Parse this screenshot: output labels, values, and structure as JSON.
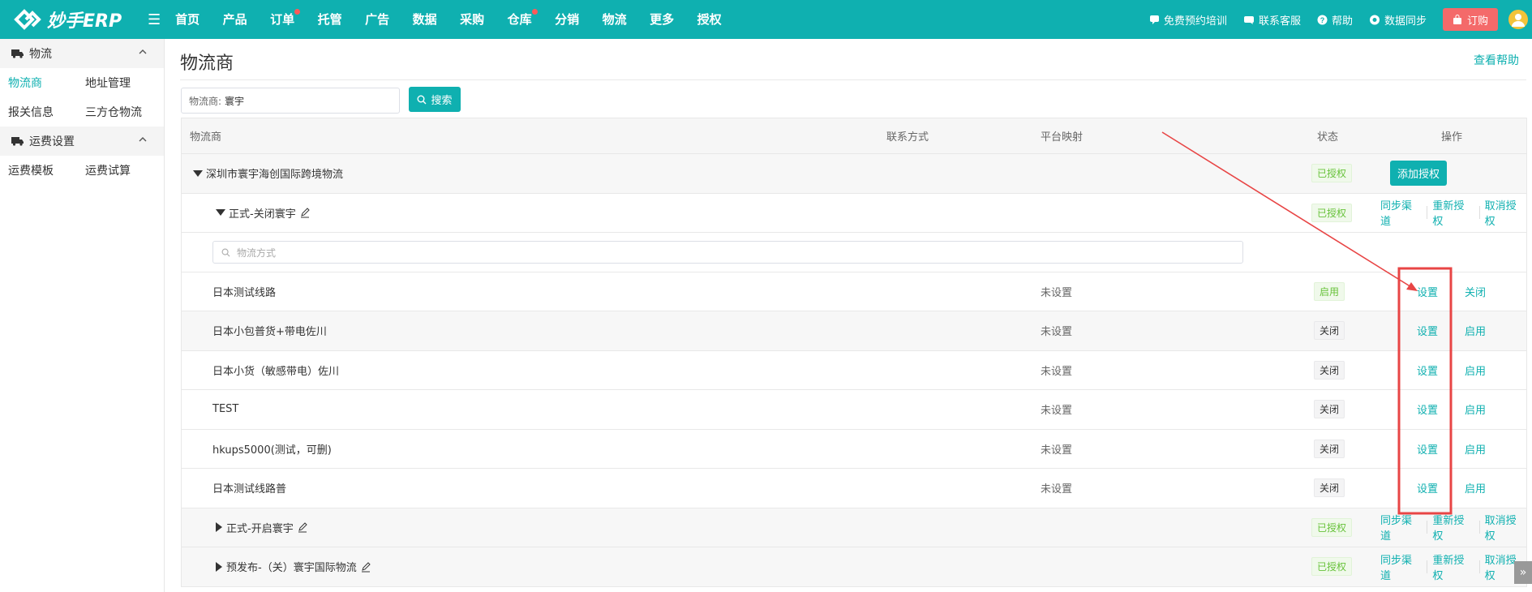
{
  "app": {
    "logo_text": "妙手ERP"
  },
  "nav": [
    "首页",
    "产品",
    "订单",
    "托管",
    "广告",
    "数据",
    "采购",
    "仓库",
    "分销",
    "物流",
    "更多",
    "授权"
  ],
  "top_right": {
    "training": "免费预约培训",
    "support": "联系客服",
    "help": "帮助",
    "sync": "数据同步",
    "order": "订购"
  },
  "sidebar": {
    "group1": "物流",
    "group1_items": [
      "物流商",
      "地址管理",
      "报关信息",
      "三方仓物流"
    ],
    "group2": "运费设置",
    "group2_items": [
      "运费模板",
      "运费试算"
    ]
  },
  "page": {
    "title": "物流商",
    "help_link": "查看帮助",
    "search_label": "物流商:",
    "search_value": "寰宇",
    "search_button": "搜索"
  },
  "table": {
    "headers": [
      "物流商",
      "联系方式",
      "平台映射",
      "状态",
      "操作"
    ],
    "provider": {
      "name": "深圳市寰宇海创国际跨境物流",
      "status": "已授权",
      "action": "添加授权"
    },
    "account1": {
      "name": "正式-关闭寰宇",
      "status": "已授权",
      "actions": [
        "同步渠道",
        "重新授权",
        "取消授权"
      ]
    },
    "method_search_placeholder": "物流方式",
    "methods": [
      {
        "name": "日本测试线路",
        "mapping": "未设置",
        "status": "启用",
        "set": "设置",
        "toggle": "关闭"
      },
      {
        "name": "日本小包普货+带电佐川",
        "mapping": "未设置",
        "status": "关闭",
        "set": "设置",
        "toggle": "启用"
      },
      {
        "name": "日本小货（敏感带电）佐川",
        "mapping": "未设置",
        "status": "关闭",
        "set": "设置",
        "toggle": "启用"
      },
      {
        "name": "TEST",
        "mapping": "未设置",
        "status": "关闭",
        "set": "设置",
        "toggle": "启用"
      },
      {
        "name": "hkups5000(测试，可删)",
        "mapping": "未设置",
        "status": "关闭",
        "set": "设置",
        "toggle": "启用"
      },
      {
        "name": "日本测试线路普",
        "mapping": "未设置",
        "status": "关闭",
        "set": "设置",
        "toggle": "启用"
      }
    ],
    "account2": {
      "name": "正式-开启寰宇",
      "status": "已授权",
      "actions": [
        "同步渠道",
        "重新授权",
        "取消授权"
      ]
    },
    "account3": {
      "name": "预发布-（关）寰宇国际物流",
      "status": "已授权",
      "actions": [
        "同步渠道",
        "重新授权",
        "取消授权"
      ]
    }
  },
  "colors": {
    "brand": "#0fb0b0",
    "annotation": "#e84545",
    "tag_green": "#67c23a"
  }
}
